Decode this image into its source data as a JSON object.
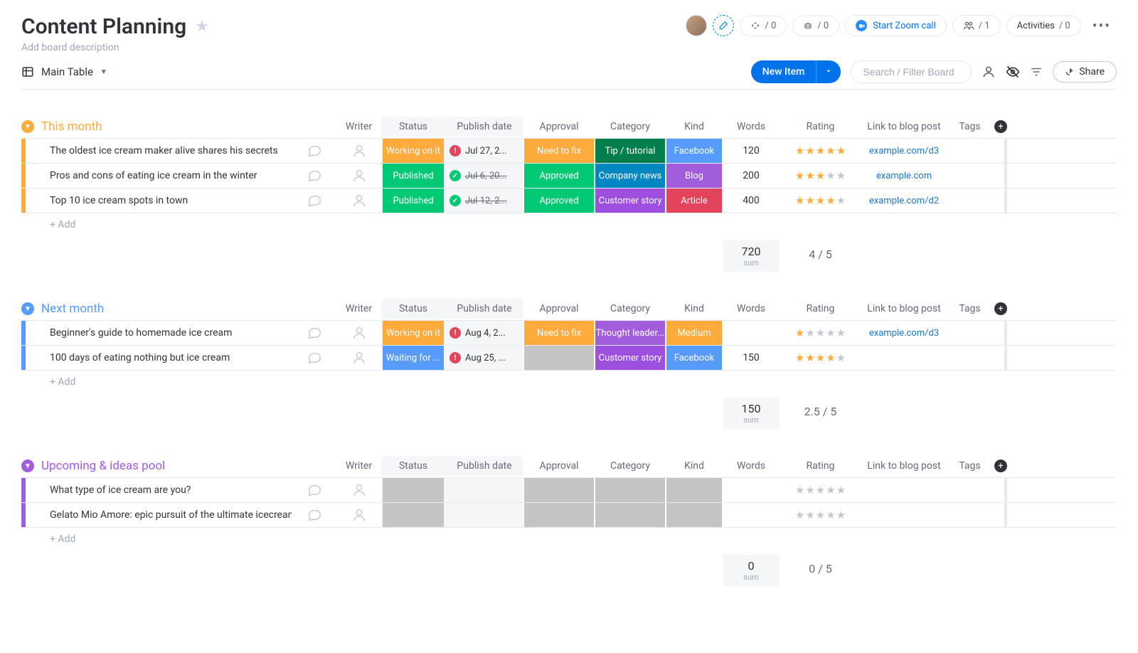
{
  "board": {
    "title": "Content Planning",
    "description": "Add board description"
  },
  "header": {
    "plug_count": "/ 0",
    "robot_count": "/ 0",
    "zoom_label": "Start Zoom call",
    "members_count": "/ 1",
    "activities_label": "Activities",
    "activities_count": "/ 0"
  },
  "toolbar": {
    "view_label": "Main Table",
    "new_item_label": "New Item",
    "search_placeholder": "Search / Filter Board",
    "share_label": "Share"
  },
  "columns": {
    "writer": "Writer",
    "status": "Status",
    "publish_date": "Publish date",
    "approval": "Approval",
    "category": "Category",
    "kind": "Kind",
    "words": "Words",
    "rating": "Rating",
    "link": "Link to blog post",
    "tags": "Tags"
  },
  "add_row_label": "+ Add",
  "colors": {
    "working_on_it": "#fdab3d",
    "published": "#00c875",
    "waiting_for": "#579bfc",
    "need_to_fix": "#fdab3d",
    "approved": "#00c875",
    "tip_tutorial": "#037f4c",
    "company_news": "#0086c0",
    "customer_story": "#9d50dd",
    "thought_leader": "#a25ddc",
    "facebook": "#579bfc",
    "blog": "#a25ddc",
    "article": "#e2445c",
    "medium": "#fdab3d",
    "alert": "#e2445c",
    "check": "#00c875",
    "empty_gray": "#c4c4c4"
  },
  "groups": [
    {
      "id": "this_month",
      "title": "This month",
      "color": "#fdab3d",
      "rows": [
        {
          "name": "The oldest ice cream maker alive shares his secrets",
          "status": "Working on it",
          "status_color": "working_on_it",
          "date": "Jul 27, 2...",
          "date_icon": "alert",
          "date_strike": false,
          "approval": "Need to fix",
          "approval_color": "need_to_fix",
          "category": "Tip / tutorial",
          "category_color": "tip_tutorial",
          "kind": "Facebook",
          "kind_color": "facebook",
          "words": "120",
          "rating": 5,
          "link": "example.com/d3"
        },
        {
          "name": "Pros and cons of eating ice cream in the winter",
          "status": "Published",
          "status_color": "published",
          "date": "Jul 6, 20...",
          "date_icon": "check",
          "date_strike": true,
          "approval": "Approved",
          "approval_color": "approved",
          "category": "Company news",
          "category_color": "company_news",
          "kind": "Blog",
          "kind_color": "blog",
          "words": "200",
          "rating": 3,
          "link": "example.com"
        },
        {
          "name": "Top 10 ice cream spots in town",
          "status": "Published",
          "status_color": "published",
          "date": "Jul 12, 2...",
          "date_icon": "check",
          "date_strike": true,
          "approval": "Approved",
          "approval_color": "approved",
          "category": "Customer story",
          "category_color": "customer_story",
          "kind": "Article",
          "kind_color": "article",
          "words": "400",
          "rating": 4,
          "link": "example.com/d2"
        }
      ],
      "summary": {
        "words_sum": "720",
        "words_label": "sum",
        "rating": "4 / 5"
      }
    },
    {
      "id": "next_month",
      "title": "Next month",
      "color": "#579bfc",
      "rows": [
        {
          "name": "Beginner's guide to homemade ice cream",
          "status": "Working on it",
          "status_color": "working_on_it",
          "date": "Aug 4, 2...",
          "date_icon": "alert",
          "date_strike": false,
          "approval": "Need to fix",
          "approval_color": "need_to_fix",
          "category": "Thought leader...",
          "category_color": "thought_leader",
          "kind": "Medium",
          "kind_color": "medium",
          "words": "",
          "rating": 1,
          "link": "example.com/d3"
        },
        {
          "name": "100 days of eating nothing but ice cream",
          "status": "Waiting for ...",
          "status_color": "waiting_for",
          "date": "Aug 25, ...",
          "date_icon": "alert",
          "date_strike": false,
          "approval": "",
          "approval_color": "empty_gray",
          "category": "Customer story",
          "category_color": "customer_story",
          "kind": "Facebook",
          "kind_color": "facebook",
          "words": "150",
          "rating": 4,
          "link": ""
        }
      ],
      "summary": {
        "words_sum": "150",
        "words_label": "sum",
        "rating": "2.5 / 5"
      }
    },
    {
      "id": "upcoming",
      "title": "Upcoming & ideas pool",
      "color": "#a25ddc",
      "rows": [
        {
          "name": "What type of ice cream are you?",
          "status": "",
          "status_color": "empty_gray",
          "date": "",
          "date_icon": "",
          "date_strike": false,
          "approval": "",
          "approval_color": "empty_gray",
          "category": "",
          "category_color": "empty_gray",
          "kind": "",
          "kind_color": "empty_gray",
          "words": "",
          "rating": 0,
          "link": ""
        },
        {
          "name": "Gelato Mio Amore: epic pursuit of the ultimate icecream",
          "status": "",
          "status_color": "empty_gray",
          "date": "",
          "date_icon": "",
          "date_strike": false,
          "approval": "",
          "approval_color": "empty_gray",
          "category": "",
          "category_color": "empty_gray",
          "kind": "",
          "kind_color": "empty_gray",
          "words": "",
          "rating": 0,
          "link": ""
        }
      ],
      "summary": {
        "words_sum": "0",
        "words_label": "sum",
        "rating": "0 / 5"
      }
    }
  ]
}
